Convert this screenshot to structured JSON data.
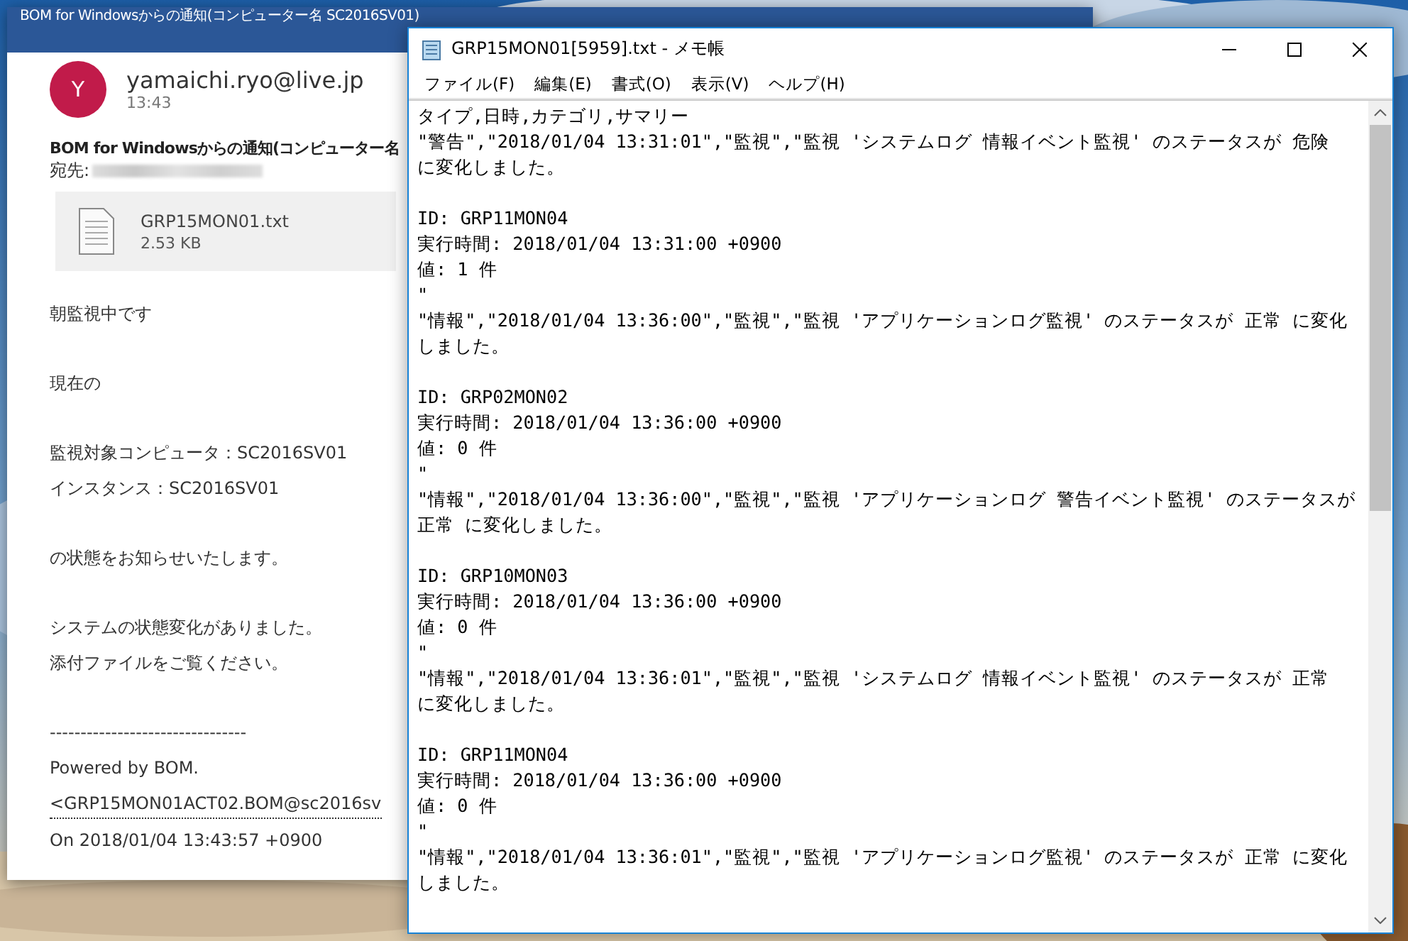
{
  "mail_window": {
    "title": "BOM for Windowsからの通知(コンピューター名 SC2016SV01)",
    "sender": {
      "initial": "Y",
      "address": "yamaichi.ryo@live.jp",
      "time": "13:43"
    },
    "subject": "BOM for Windowsからの通知(コンピューター名",
    "to_label": "宛先:",
    "attachment": {
      "name": "GRP15MON01.txt",
      "size": "2.53 KB"
    },
    "body": [
      [
        {
          "kind": "text",
          "text": "朝監視中です"
        }
      ],
      [
        {
          "kind": "text",
          "text": "現在の"
        }
      ],
      [
        {
          "kind": "text",
          "text": "監視対象コンピュータ：SC2016SV01"
        },
        {
          "kind": "text",
          "text": "インスタンス：SC2016SV01"
        }
      ],
      [
        {
          "kind": "text",
          "text": "の状態をお知らせいたします。"
        }
      ],
      [
        {
          "kind": "text",
          "text": "システムの状態変化がありました。"
        },
        {
          "kind": "text",
          "text": "添付ファイルをご覧ください。"
        }
      ],
      [
        {
          "kind": "text",
          "text": "--------------------------------"
        },
        {
          "kind": "text",
          "text": "Powered by BOM."
        },
        {
          "kind": "link",
          "text": "<GRP15MON01ACT02.BOM@sc2016sv"
        },
        {
          "kind": "text",
          "text": "On 2018/01/04 13:43:57 +0900"
        }
      ]
    ]
  },
  "notepad": {
    "title": "GRP15MON01[5959].txt - メモ帳",
    "menu": [
      "ファイル(F)",
      "編集(E)",
      "書式(O)",
      "表示(V)",
      "ヘルプ(H)"
    ],
    "blocks": [
      [
        "タイプ,日時,カテゴリ,サマリー",
        "\"警告\",\"2018/01/04 13:31:01\",\"監視\",\"監視 'システムログ 情報イベント監視' のステータスが 危険",
        "に変化しました。"
      ],
      [
        "ID: GRP11MON04",
        "実行時間: 2018/01/04 13:31:00 +0900",
        "値: 1 件",
        "\"",
        "\"情報\",\"2018/01/04 13:36:00\",\"監視\",\"監視 'アプリケーションログ監視' のステータスが 正常 に変化",
        "しました。"
      ],
      [
        "ID: GRP02MON02",
        "実行時間: 2018/01/04 13:36:00 +0900",
        "値: 0 件",
        "\"",
        "\"情報\",\"2018/01/04 13:36:00\",\"監視\",\"監視 'アプリケーションログ 警告イベント監視' のステータスが",
        "正常 に変化しました。"
      ],
      [
        "ID: GRP10MON03",
        "実行時間: 2018/01/04 13:36:00 +0900",
        "値: 0 件",
        "\"",
        "\"情報\",\"2018/01/04 13:36:01\",\"監視\",\"監視 'システムログ 情報イベント監視' のステータスが 正常",
        "に変化しました。"
      ],
      [
        "ID: GRP11MON04",
        "実行時間: 2018/01/04 13:36:00 +0900",
        "値: 0 件",
        "\"",
        "\"情報\",\"2018/01/04 13:36:01\",\"監視\",\"監視 'アプリケーションログ監視' のステータスが 正常 に変化",
        "しました。"
      ]
    ]
  }
}
